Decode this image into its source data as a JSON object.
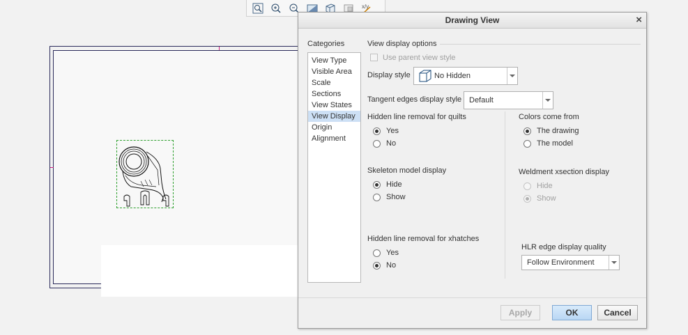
{
  "dialog": {
    "title": "Drawing View",
    "close_glyph": "×"
  },
  "categories": {
    "label": "Categories",
    "items": [
      "View Type",
      "Visible Area",
      "Scale",
      "Sections",
      "View States",
      "View Display",
      "Origin",
      "Alignment"
    ],
    "selected": "View Display"
  },
  "options": {
    "section_title": "View display options",
    "use_parent_label": "Use parent view style",
    "display_style_label": "Display style",
    "display_style_value": "No Hidden",
    "tangent_label": "Tangent edges display style",
    "tangent_value": "Default",
    "hlr_quilts": {
      "label": "Hidden line removal for quilts",
      "yes": "Yes",
      "no": "No",
      "selected": "Yes"
    },
    "skeleton": {
      "label": "Skeleton model display",
      "hide": "Hide",
      "show": "Show",
      "selected": "Hide"
    },
    "hlr_xhatches": {
      "label": "Hidden line removal for xhatches",
      "yes": "Yes",
      "no": "No",
      "selected": "No"
    },
    "colors": {
      "label": "Colors come from",
      "drawing": "The drawing",
      "model": "The model",
      "selected": "The drawing"
    },
    "weldment": {
      "label": "Weldment xsection display",
      "hide": "Hide",
      "show": "Show",
      "selected": "Show"
    },
    "hlr_quality": {
      "label": "HLR edge display quality",
      "value": "Follow Environment"
    }
  },
  "buttons": {
    "apply": "Apply",
    "ok": "OK",
    "cancel": "Cancel"
  },
  "toolbar": {
    "icons": [
      "zoom-window-icon",
      "zoom-in-icon",
      "zoom-out-icon",
      "refit-icon",
      "view-cube-icon",
      "repaint-icon",
      "datum-display-icon"
    ]
  },
  "colors": {
    "selection": "#cde0f5",
    "sheet_border": "#2a2a5a",
    "view_outline": "#2fa02f"
  }
}
